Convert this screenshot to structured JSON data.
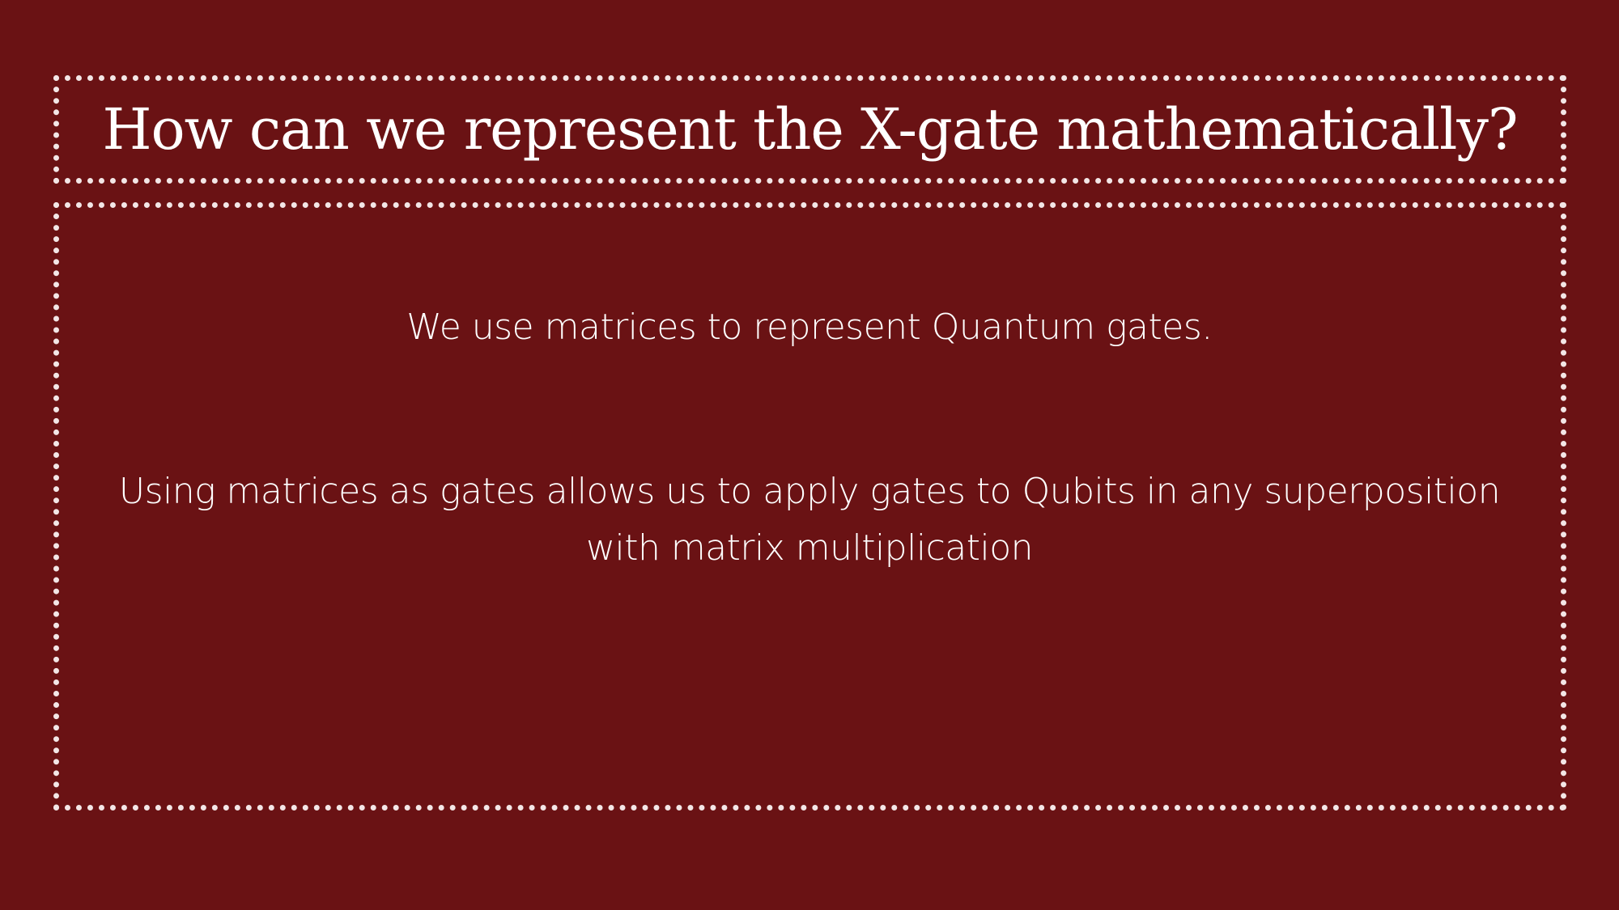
{
  "slide": {
    "title": "How can we represent the X-gate mathematically?",
    "paragraphs": [
      "We use matrices to represent Quantum gates.",
      "Using matrices as gates allows us to apply gates to Qubits in any superposition with matrix multiplication"
    ],
    "colors": {
      "background": "#6a1214",
      "text": "#ffffff",
      "border": "#f3e6e6"
    }
  }
}
